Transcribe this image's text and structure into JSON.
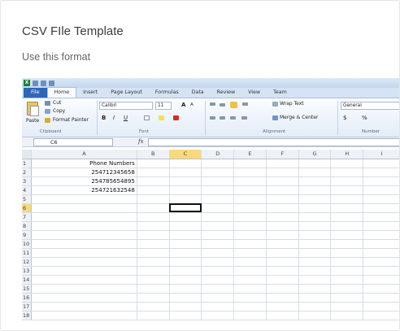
{
  "card": {
    "title": "CSV FIle Template",
    "subtitle": "Use this format"
  },
  "excel": {
    "ribbon_tabs": [
      "File",
      "Home",
      "Insert",
      "Page Layout",
      "Formulas",
      "Data",
      "Review",
      "View",
      "Team"
    ],
    "active_tab": "Home",
    "clipboard": {
      "paste": "Paste",
      "cut": "Cut",
      "copy": "Copy",
      "format_painter": "Format Painter",
      "label": "Clipboard"
    },
    "font": {
      "name": "Calibri",
      "size": "11",
      "grow": "A",
      "shrink": "A",
      "bold": "B",
      "italic": "I",
      "underline": "U",
      "label": "Font"
    },
    "alignment": {
      "wrap_text": "Wrap Text",
      "merge_center": "Merge & Center",
      "label": "Alignment"
    },
    "number": {
      "format": "General",
      "currency": "$",
      "percent": "%",
      "label": "Number"
    },
    "name_box": "C6",
    "fx": "fx",
    "columns": [
      "A",
      "B",
      "C",
      "D",
      "E",
      "F",
      "G",
      "H",
      "I"
    ],
    "selected_column": "C",
    "selected_row": "6",
    "rows": [
      {
        "n": "1",
        "a": "Phone Numbers"
      },
      {
        "n": "2",
        "a": "254712345658"
      },
      {
        "n": "3",
        "a": "254785654895"
      },
      {
        "n": "4",
        "a": "254721632548"
      },
      {
        "n": "5",
        "a": ""
      },
      {
        "n": "6",
        "a": ""
      },
      {
        "n": "7",
        "a": ""
      },
      {
        "n": "8",
        "a": ""
      },
      {
        "n": "9",
        "a": ""
      },
      {
        "n": "10",
        "a": ""
      },
      {
        "n": "11",
        "a": ""
      },
      {
        "n": "12",
        "a": ""
      },
      {
        "n": "13",
        "a": ""
      },
      {
        "n": "14",
        "a": ""
      },
      {
        "n": "15",
        "a": ""
      },
      {
        "n": "16",
        "a": ""
      },
      {
        "n": "17",
        "a": ""
      },
      {
        "n": "18",
        "a": ""
      }
    ],
    "colors": {
      "file_tab": "#2f66b5",
      "selection_header": "#f9d87f",
      "ribbon": "#e3ecf7"
    }
  }
}
